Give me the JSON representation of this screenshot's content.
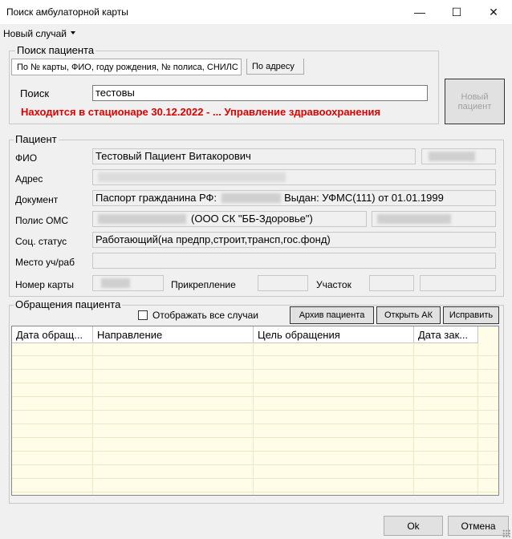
{
  "window": {
    "title": "Поиск амбулаторной карты",
    "minimize_glyph": "—",
    "maximize_glyph": "☐",
    "close_glyph": "✕"
  },
  "menu": {
    "new_case": "Новый случай"
  },
  "search_group": {
    "legend": "Поиск пациента",
    "tab_main": "По № карты, ФИО, году рождения, № полиса, СНИЛС",
    "tab_address": "По адресу",
    "search_label": "Поиск",
    "search_value": "тестовы",
    "warning": "Находится в стационаре 30.12.2022 -  ... Управление здравоохранения",
    "new_patient_label": "Новый пациент"
  },
  "patient_group": {
    "legend": "Пациент",
    "fio_label": "ФИО",
    "fio_value": "Тестовый Пациент Витакорович",
    "address_label": "Адрес",
    "document_label": "Документ",
    "document_prefix": "Паспорт гражданина РФ:",
    "document_suffix": "Выдан: УФМС(111) от 01.01.1999",
    "oms_label": "Полис ОМС",
    "oms_company": "(ООО СК \"ББ-Здоровье\")",
    "social_label": "Соц. статус",
    "social_value": "Работающий(на предпр,строит,трансп,гос.фонд)",
    "work_label": "Место уч/раб",
    "card_label": "Номер карты",
    "attach_label": "Прикрепление",
    "district_label": "Участок"
  },
  "visits_group": {
    "legend": "Обращения пациента",
    "show_all_label": "Отображать все случаи",
    "archive_button": "Архив пациента",
    "open_ak_button": "Открыть АК",
    "fix_button": "Исправить",
    "columns": [
      "Дата обращ...",
      "Направление",
      "Цель обращения",
      "Дата зак..."
    ]
  },
  "footer": {
    "ok": "Ok",
    "cancel": "Отмена"
  }
}
